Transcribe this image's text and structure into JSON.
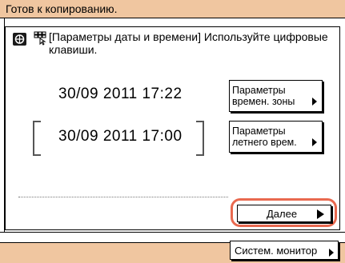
{
  "status": {
    "text": "Готов к копированию."
  },
  "message": {
    "text": "[Параметры даты и времени] Используйте цифровые клавиши."
  },
  "datetime": {
    "current": "30/09 2011 17:22",
    "new_value": "30/09 2011 17:00"
  },
  "buttons": {
    "timezone_label": "Параметры времен. зоны",
    "dst_label": "Параметры летнего врем.",
    "next_label": "Далее",
    "monitor_label": "Систем. монитор"
  },
  "colors": {
    "status_bar_bg": "#f0c6a0",
    "highlight": "#e9694f"
  },
  "icons": [
    "settings-icon",
    "keypad-icon",
    "right-arrow-icon"
  ]
}
